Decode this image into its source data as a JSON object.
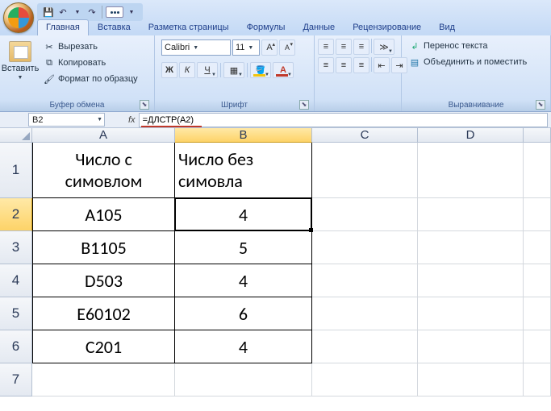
{
  "qat": {
    "save": "💾",
    "undo": "↶",
    "redo": "↷"
  },
  "tabs": [
    "Главная",
    "Вставка",
    "Разметка страницы",
    "Формулы",
    "Данные",
    "Рецензирование",
    "Вид"
  ],
  "active_tab": 0,
  "clipboard": {
    "paste": "Вставить",
    "cut": "Вырезать",
    "copy": "Копировать",
    "format_painter": "Формат по образцу",
    "label": "Буфер обмена"
  },
  "font": {
    "name": "Calibri",
    "size": "11",
    "bold": "Ж",
    "italic": "К",
    "underline": "Ч",
    "label": "Шрифт"
  },
  "align": {
    "label": "Выравнивание",
    "wrap": "Перенос текста",
    "merge": "Объединить и поместить"
  },
  "namebox": "B2",
  "formula": "=ДЛСТР(A2)",
  "columns": [
    "A",
    "B",
    "C",
    "D"
  ],
  "rows": [
    "1",
    "2",
    "3",
    "4",
    "5",
    "6",
    "7"
  ],
  "table": {
    "header_a": "Число с симовлом",
    "header_b": "Число без симовла",
    "data": [
      {
        "a": "A105",
        "b": "4"
      },
      {
        "a": "B1105",
        "b": "5"
      },
      {
        "a": "D503",
        "b": "4"
      },
      {
        "a": "E60102",
        "b": "6"
      },
      {
        "a": "C201",
        "b": "4"
      }
    ]
  },
  "active_cell": {
    "row": 2,
    "col": "B"
  }
}
